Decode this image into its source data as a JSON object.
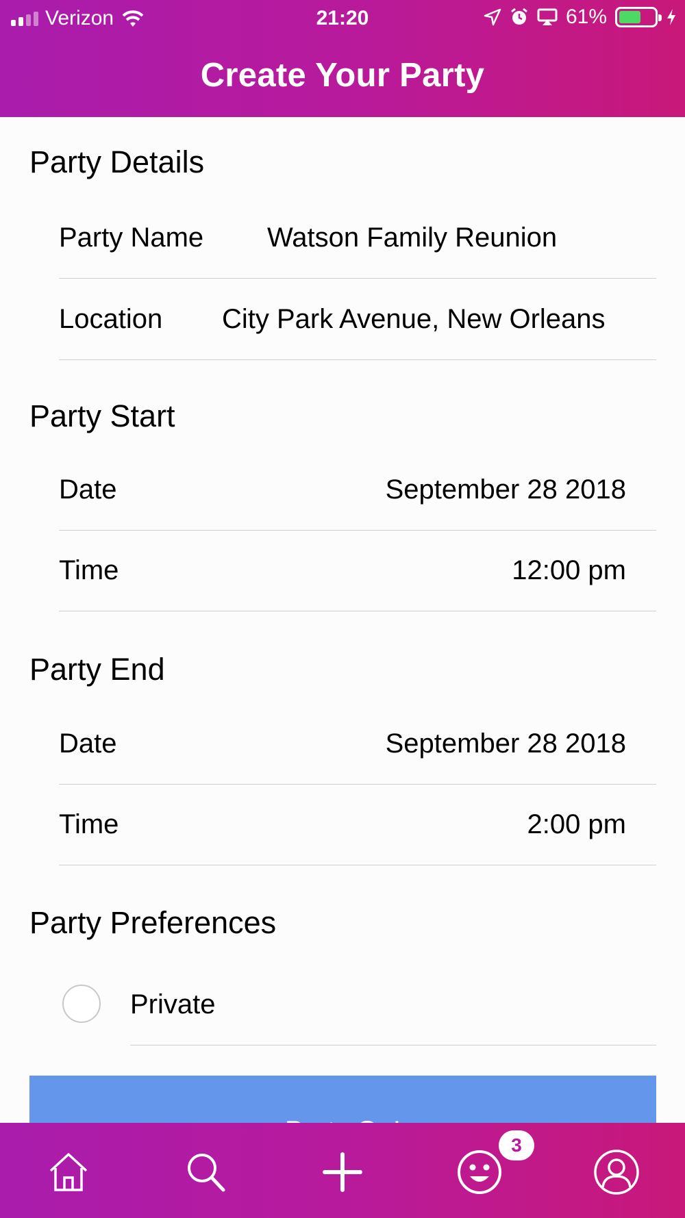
{
  "status_bar": {
    "carrier": "Verizon",
    "time": "21:20",
    "battery_percent": "61%",
    "battery_level": 0.61
  },
  "header": {
    "title": "Create Your Party"
  },
  "sections": {
    "details": {
      "title": "Party Details",
      "party_name_label": "Party Name",
      "party_name_value": "Watson Family Reunion",
      "location_label": "Location",
      "location_value": "City Park Avenue, New Orleans"
    },
    "start": {
      "title": "Party Start",
      "date_label": "Date",
      "date_value": "September 28 2018",
      "time_label": "Time",
      "time_value": "12:00 pm"
    },
    "end": {
      "title": "Party End",
      "date_label": "Date",
      "date_value": "September 28 2018",
      "time_label": "Time",
      "time_value": "2:00 pm"
    },
    "preferences": {
      "title": "Party Preferences",
      "private_label": "Private",
      "private_checked": false
    }
  },
  "submit": {
    "label": "Party On!"
  },
  "tab_bar": {
    "items": [
      {
        "icon": "home-icon"
      },
      {
        "icon": "search-icon"
      },
      {
        "icon": "plus-icon"
      },
      {
        "icon": "smiley-icon",
        "badge": "3"
      },
      {
        "icon": "profile-icon"
      }
    ]
  },
  "colors": {
    "gradient_start": "#a91cac",
    "gradient_end": "#c81879",
    "button": "#6496ec",
    "battery": "#4cd964"
  }
}
